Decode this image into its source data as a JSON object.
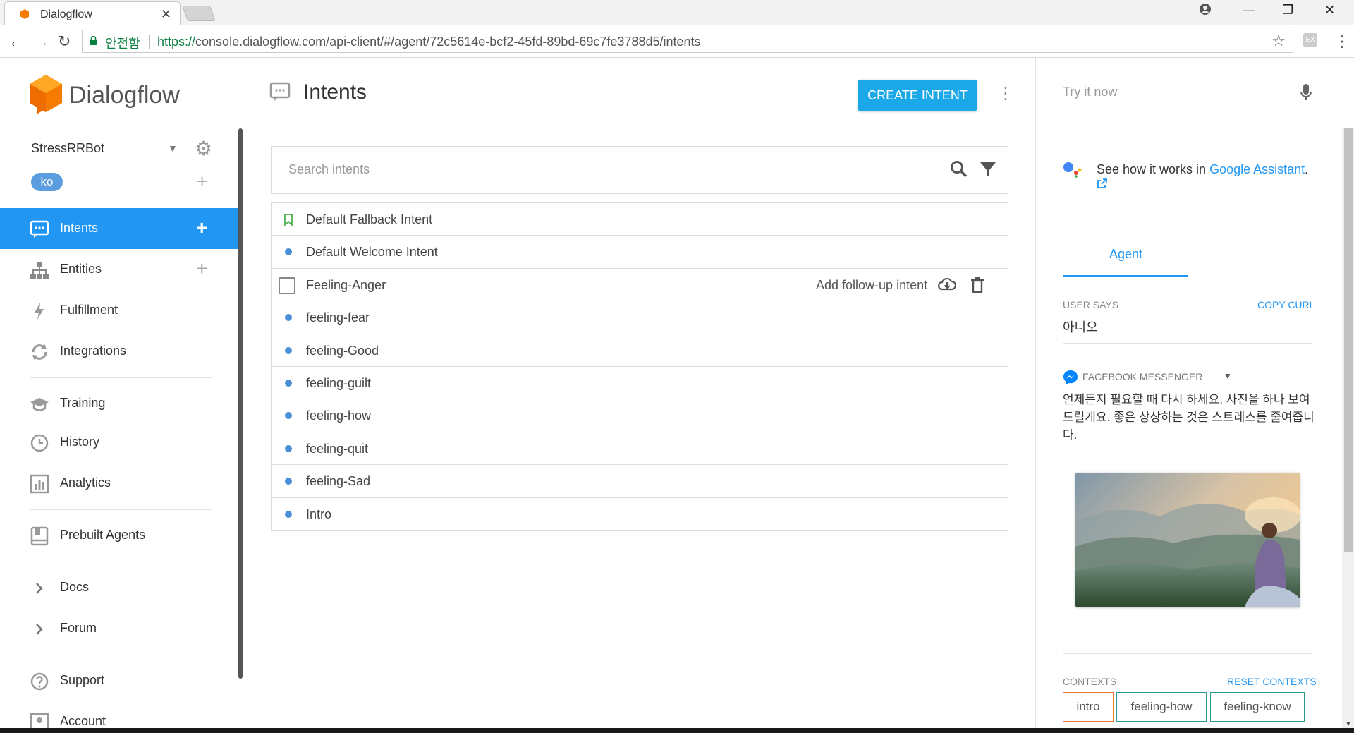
{
  "browser": {
    "tab_title": "Dialogflow",
    "secure_label": "안전함",
    "url_scheme": "https://",
    "url_rest": "console.dialogflow.com/api-client/#/agent/72c5614e-bcf2-45fd-89bd-69c7fe3788d5/intents"
  },
  "sidebar": {
    "brand": "Dialogflow",
    "agent_name": "StressRRBot",
    "language": "ko",
    "items": [
      {
        "label": "Intents",
        "icon": "chat-icon",
        "active": true,
        "has_add": true
      },
      {
        "label": "Entities",
        "icon": "hierarchy-icon",
        "active": false,
        "has_add": true
      },
      {
        "label": "Fulfillment",
        "icon": "bolt-icon",
        "active": false,
        "has_add": false
      },
      {
        "label": "Integrations",
        "icon": "sync-icon",
        "active": false,
        "has_add": false
      },
      {
        "label": "Training",
        "icon": "graduation-cap-icon",
        "active": false,
        "has_add": false
      },
      {
        "label": "History",
        "icon": "clock-icon",
        "active": false,
        "has_add": false
      },
      {
        "label": "Analytics",
        "icon": "bar-chart-icon",
        "active": false,
        "has_add": false
      },
      {
        "label": "Prebuilt Agents",
        "icon": "book-icon",
        "active": false,
        "has_add": false
      },
      {
        "label": "Docs",
        "icon": "chevron-right-icon",
        "active": false,
        "has_add": false
      },
      {
        "label": "Forum",
        "icon": "chevron-right-icon",
        "active": false,
        "has_add": false
      },
      {
        "label": "Support",
        "icon": "help-icon",
        "active": false,
        "has_add": false
      },
      {
        "label": "Account",
        "icon": "account-icon",
        "active": false,
        "has_add": false
      }
    ]
  },
  "main": {
    "title": "Intents",
    "create_button": "CREATE INTENT",
    "search_placeholder": "Search intents",
    "intents": [
      {
        "name": "Default Fallback Intent",
        "marker": "bookmark"
      },
      {
        "name": "Default Welcome Intent",
        "marker": "dot"
      },
      {
        "name": "Feeling-Anger",
        "marker": "checkbox",
        "hovered": true
      },
      {
        "name": "feeling-fear",
        "marker": "dot"
      },
      {
        "name": "feeling-Good",
        "marker": "dot"
      },
      {
        "name": "feeling-guilt",
        "marker": "dot"
      },
      {
        "name": "feeling-how",
        "marker": "dot"
      },
      {
        "name": "feeling-quit",
        "marker": "dot"
      },
      {
        "name": "feeling-Sad",
        "marker": "dot"
      },
      {
        "name": "Intro",
        "marker": "dot"
      }
    ],
    "add_followup_label": "Add follow-up intent"
  },
  "try_panel": {
    "placeholder": "Try it now",
    "ga_prefix": "See how it works in ",
    "ga_link": "Google Assistant",
    "ga_suffix": ".",
    "agent_tab": "Agent",
    "user_says_label": "USER SAYS",
    "copy_curl": "COPY CURL",
    "user_says_value": "아니오",
    "platform_label": "FACEBOOK MESSENGER",
    "response_text": "언제든지 필요할 때 다시 하세요. 사진을 하나 보여드릴게요. 좋은 상상하는 것은 스트레스를 줄여줍니다.",
    "contexts_label": "CONTEXTS",
    "reset_contexts": "RESET CONTEXTS",
    "contexts": [
      "intro",
      "feeling-how",
      "feeling-know"
    ]
  },
  "colors": {
    "accent": "#2196f3",
    "create_button": "#1ba8e8",
    "brand_orange": "#f57c00",
    "intent_dot": "#4a90d9"
  }
}
